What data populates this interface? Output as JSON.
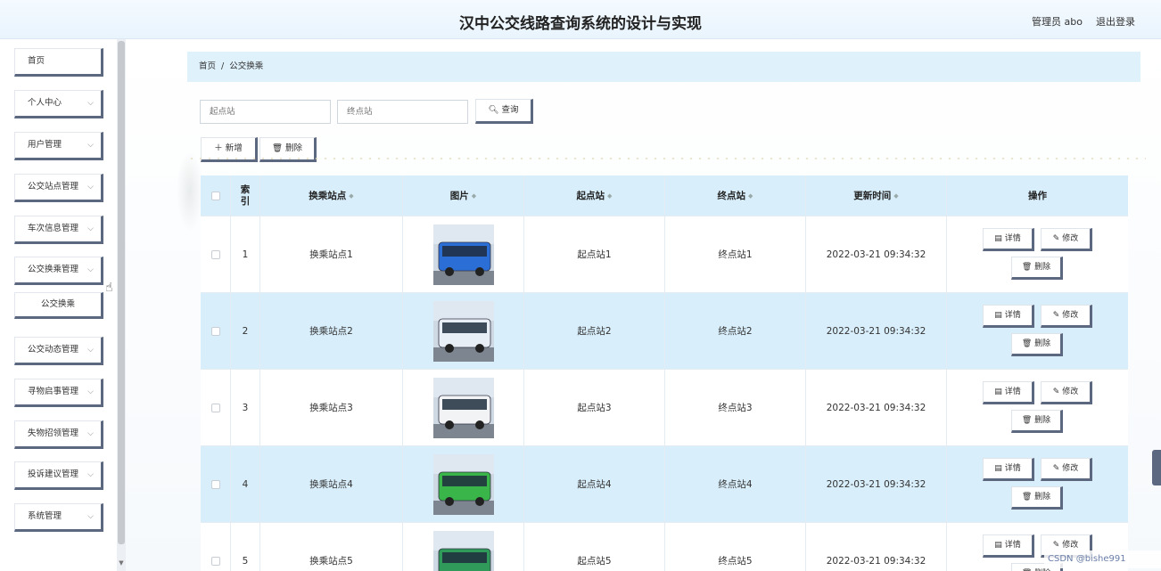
{
  "header": {
    "title": "汉中公交线路查询系统的设计与实现",
    "user": "管理员 abo",
    "logout": "退出登录"
  },
  "sidebar": {
    "items": [
      {
        "label": "首页",
        "has_chevron": false
      },
      {
        "label": "个人中心",
        "has_chevron": true
      },
      {
        "label": "用户管理",
        "has_chevron": true
      },
      {
        "label": "公交站点管理",
        "has_chevron": true
      },
      {
        "label": "车次信息管理",
        "has_chevron": true
      },
      {
        "label": "公交换乘管理",
        "has_chevron": true
      },
      {
        "label": "公交换乘",
        "sub": true
      },
      {
        "label": "公交动态管理",
        "has_chevron": true
      },
      {
        "label": "寻物启事管理",
        "has_chevron": true
      },
      {
        "label": "失物招领管理",
        "has_chevron": true
      },
      {
        "label": "投诉建议管理",
        "has_chevron": true
      },
      {
        "label": "系统管理",
        "has_chevron": true
      }
    ]
  },
  "breadcrumb": {
    "home": "首页",
    "sep": "/",
    "current": "公交换乘"
  },
  "search": {
    "start_placeholder": "起点站",
    "end_placeholder": "终点站",
    "query_label": "查询"
  },
  "toolbar": {
    "add_label": "新增",
    "delete_label": "删除"
  },
  "table": {
    "headers": {
      "index": "索引",
      "transfer": "换乘站点",
      "image": "图片",
      "start": "起点站",
      "end": "终点站",
      "updated": "更新时间",
      "ops": "操作"
    },
    "op_labels": {
      "detail": "详情",
      "edit": "修改",
      "delete": "删除"
    },
    "rows": [
      {
        "index": "1",
        "transfer": "换乘站点1",
        "start": "起点站1",
        "end": "终点站1",
        "updated": "2022-03-21 09:34:32",
        "bus_color": "#2b6fd6"
      },
      {
        "index": "2",
        "transfer": "换乘站点2",
        "start": "起点站2",
        "end": "终点站2",
        "updated": "2022-03-21 09:34:32",
        "bus_color": "#e8eef5"
      },
      {
        "index": "3",
        "transfer": "换乘站点3",
        "start": "起点站3",
        "end": "终点站3",
        "updated": "2022-03-21 09:34:32",
        "bus_color": "#f1f3f4"
      },
      {
        "index": "4",
        "transfer": "换乘站点4",
        "start": "起点站4",
        "end": "终点站4",
        "updated": "2022-03-21 09:34:32",
        "bus_color": "#3ab54a"
      },
      {
        "index": "5",
        "transfer": "换乘站点5",
        "start": "起点站5",
        "end": "终点站5",
        "updated": "2022-03-21 09:34:32",
        "bus_color": "#2f9a5a"
      }
    ]
  },
  "watermark": "CSDN @bishe991",
  "colors": {
    "accent": "#d8eefb",
    "button_shadow": "#5c6780"
  }
}
